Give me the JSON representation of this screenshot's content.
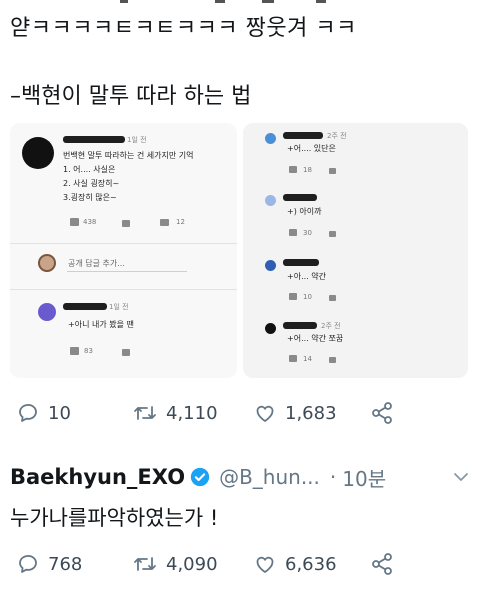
{
  "post1": {
    "line1": "얃ㅋㅋㅋㅋㅌㅋㅌㅋㅋㅋ 짱웃겨 ㅋㅋ",
    "line2": "–백현이 말투 따라 하는 법"
  },
  "screenshot_left": {
    "comment": {
      "time": "1일 전",
      "lines": [
        "번백현 말투 따라하는 건 세가지만 기억",
        "1. 어.... 사실은",
        "2. 사실 굉장히~",
        "3.굉장히 많은~"
      ],
      "likes": "438",
      "replies": "12"
    },
    "reply_placeholder": "공개 답글 추가...",
    "reply": {
      "time": "1일 전",
      "text": "+아니 내가 봤을 땐",
      "likes": "83"
    }
  },
  "screenshot_right": {
    "items": [
      {
        "time": "2주 전",
        "text": "+어.... 있단은",
        "likes": "18"
      },
      {
        "time": "",
        "text": "+) 아이까",
        "likes": "30"
      },
      {
        "time": "",
        "text": "+아... 약간",
        "likes": "10"
      },
      {
        "time": "2주 전",
        "text": "+어... 약간 쪼꿈",
        "likes": "14"
      }
    ]
  },
  "post1_actions": {
    "replies": "10",
    "retweets": "4,110",
    "likes": "1,683"
  },
  "tweet": {
    "display_name": "Baekhyun_EXO",
    "handle": "@B_hun...",
    "separator": "·",
    "time": "10분",
    "text": "누가나를파악하였는가 !",
    "replies": "768",
    "retweets": "4,090",
    "likes": "6,636"
  },
  "colors": {
    "icon_gray": "#657786",
    "verified_blue": "#1da1f2",
    "text": "#14171a"
  }
}
